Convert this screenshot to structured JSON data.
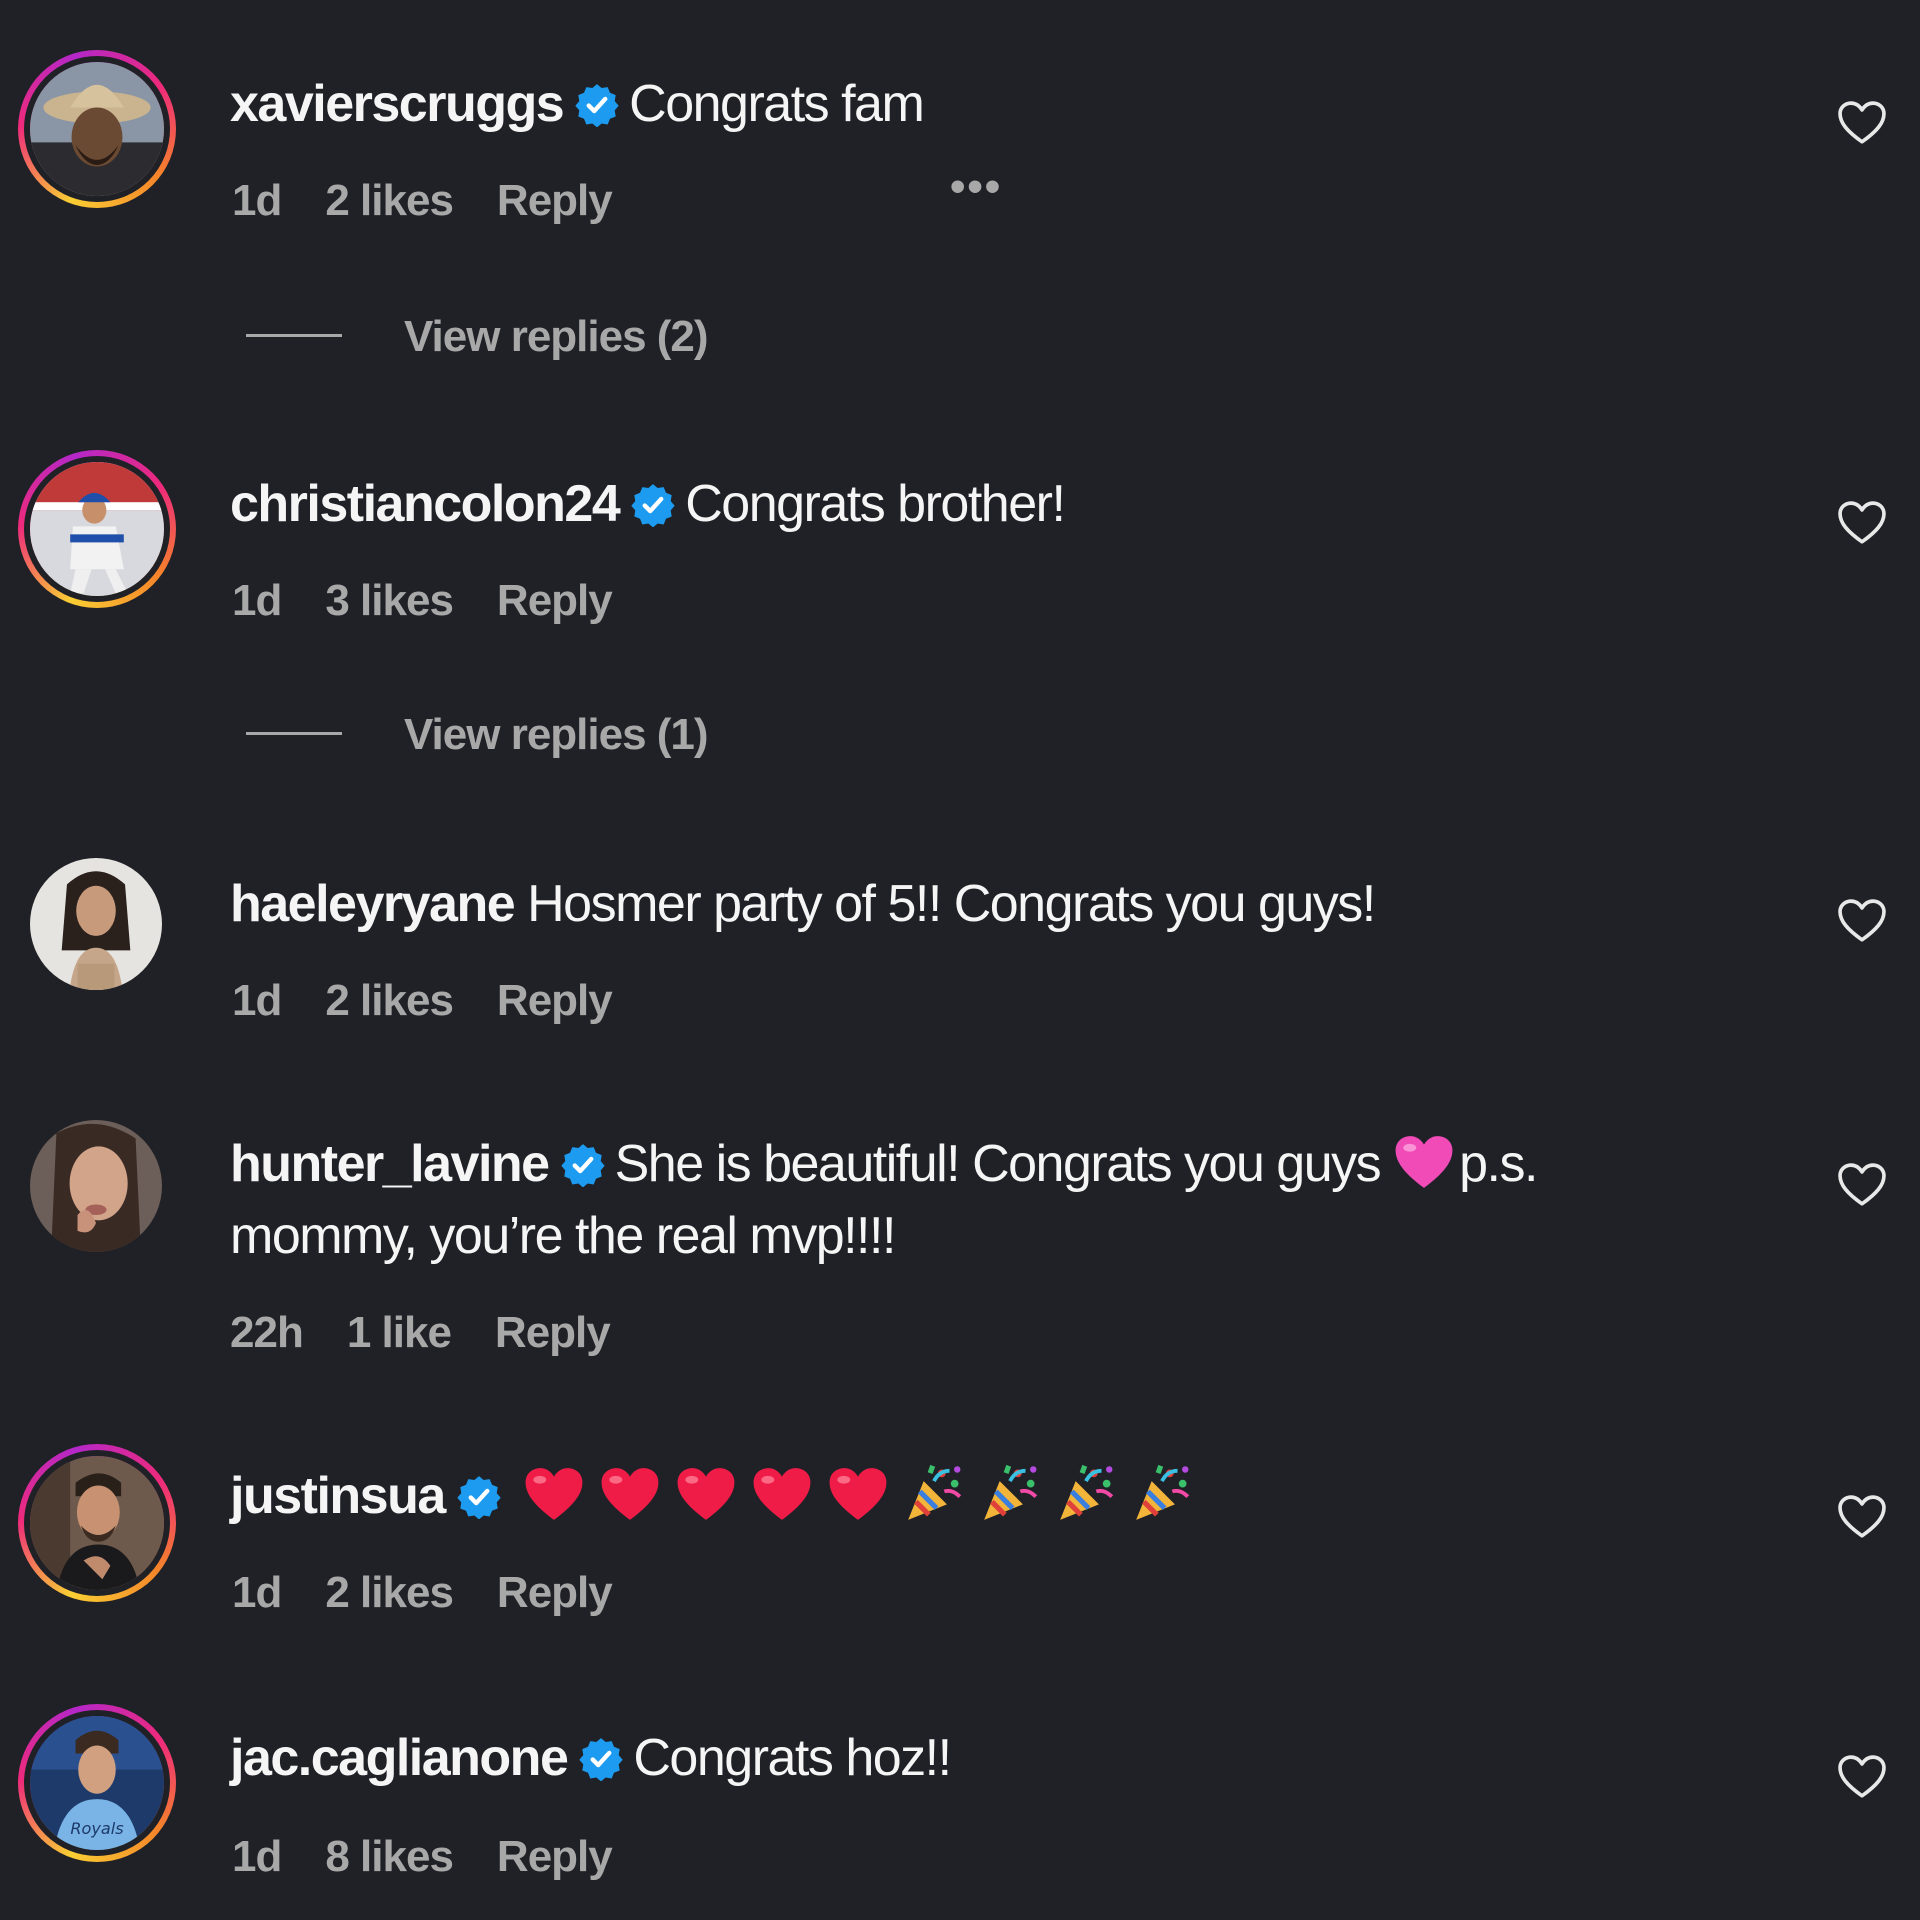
{
  "colors": {
    "background": "#202127",
    "text": "#f5f5f5",
    "muted": "#a8a8a8",
    "verified": "#1d9bf0"
  },
  "comments": [
    {
      "username": "xavierscruggs",
      "verified": true,
      "text": "Congrats fam",
      "time": "1d",
      "likes": "2 likes",
      "reply": "Reply",
      "more": "•••",
      "view_replies": "View replies (2)"
    },
    {
      "username": "christiancolon24",
      "verified": true,
      "text": "Congrats brother!",
      "time": "1d",
      "likes": "3 likes",
      "reply": "Reply",
      "view_replies": "View replies (1)"
    },
    {
      "username": "haeleyryane",
      "verified": false,
      "text": "Hosmer party of 5!! Congrats you guys!",
      "time": "1d",
      "likes": "2 likes",
      "reply": "Reply"
    },
    {
      "username": "hunter_lavine",
      "verified": true,
      "text_before_emoji": "She is beautiful! Congrats you guys",
      "emoji": "pink-heart",
      "text_after_emoji": "p.s. mommy, you’re the real mvp!!!!",
      "time": "22h",
      "likes": "1 like",
      "reply": "Reply"
    },
    {
      "username": "justinsua",
      "verified": true,
      "emojis": [
        "red-heart",
        "red-heart",
        "red-heart",
        "red-heart",
        "red-heart",
        "party-popper",
        "party-popper",
        "party-popper",
        "party-popper"
      ],
      "time": "1d",
      "likes": "2 likes",
      "reply": "Reply"
    },
    {
      "username": "jac.caglianone",
      "verified": true,
      "text": "Congrats hoz!!",
      "time": "1d",
      "likes": "8 likes",
      "reply": "Reply"
    }
  ]
}
